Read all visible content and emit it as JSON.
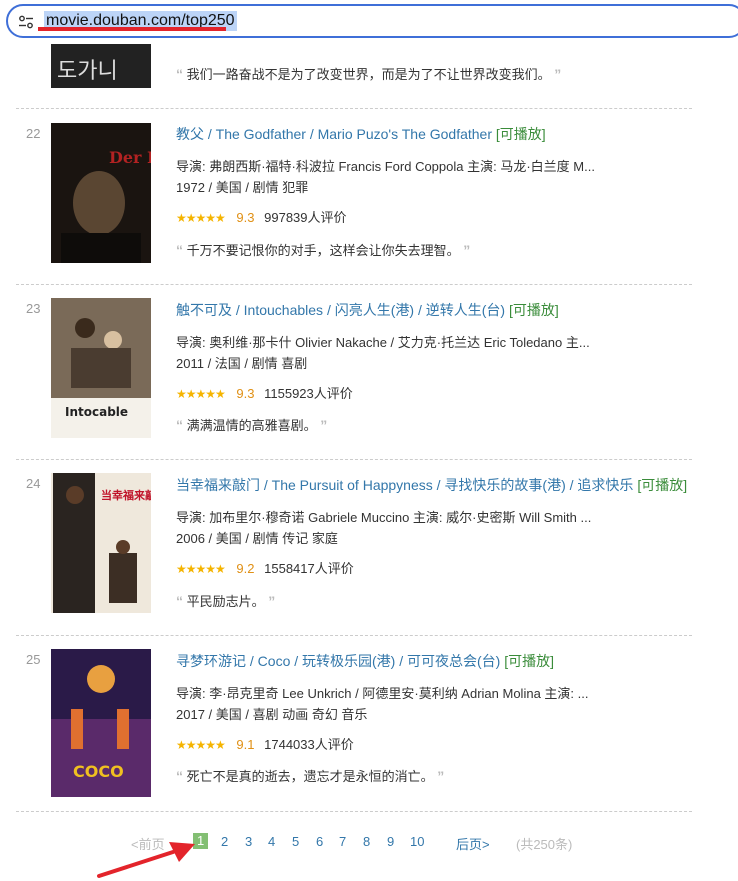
{
  "browser": {
    "url": "movie.douban.com/top250"
  },
  "items": [
    {
      "quote": "我们一路奋战不是为了改变世界，而是为了不让世界改变我们。"
    },
    {
      "rank": "22",
      "title_main": "教父",
      "title_other": " / The Godfather  / Mario Puzo's The Godfather",
      "playable": "[可播放]",
      "meta1": "导演: 弗朗西斯·福特·科波拉 Francis Ford Coppola   主演: 马龙·白兰度 M...",
      "meta2": "1972 / 美国 / 剧情 犯罪",
      "stars": "★★★★★",
      "score": "9.3",
      "votes": "997839人评价",
      "quote": "千万不要记恨你的对手，这样会让你失去理智。"
    },
    {
      "rank": "23",
      "title_main": "触不可及",
      "title_other": " / Intouchables  / 闪亮人生(港) / 逆转人生(台)",
      "playable": "[可播放]",
      "meta1": "导演: 奥利维·那卡什 Olivier Nakache / 艾力克·托兰达 Eric Toledano   主...",
      "meta2": "2011 / 法国 / 剧情 喜剧",
      "stars": "★★★★★",
      "score": "9.3",
      "votes": "1155923人评价",
      "quote": "满满温情的高雅喜剧。"
    },
    {
      "rank": "24",
      "title_main": "当幸福来敲门",
      "title_other": " / The Pursuit of Happyness  / 寻找快乐的故事(港) / 追求快乐",
      "playable": "[可播放]",
      "meta1": "导演: 加布里尔·穆奇诺 Gabriele Muccino   主演: 威尔·史密斯 Will Smith ...",
      "meta2": "2006 / 美国 / 剧情 传记 家庭",
      "stars": "★★★★★",
      "score": "9.2",
      "votes": "1558417人评价",
      "quote": "平民励志片。"
    },
    {
      "rank": "25",
      "title_main": "寻梦环游记",
      "title_other": " / Coco  / 玩转极乐园(港) / 可可夜总会(台)",
      "playable": "[可播放]",
      "meta1": "导演: 李·昂克里奇 Lee Unkrich / 阿德里安·莫利纳 Adrian Molina   主演: ...",
      "meta2": "2017 / 美国 / 喜剧 动画 奇幻 音乐",
      "stars": "★★★★★",
      "score": "9.1",
      "votes": "1744033人评价",
      "quote": "死亡不是真的逝去，遗忘才是永恒的消亡。"
    }
  ],
  "poster_text": {
    "p0": "도가니",
    "p1": "Der Pate",
    "p2": "Intocable",
    "p3": "当幸福来敲门",
    "p4": "COCO"
  },
  "pagination": {
    "prev": "<前页",
    "pages": [
      "1",
      "2",
      "3",
      "4",
      "5",
      "6",
      "7",
      "8",
      "9",
      "10"
    ],
    "current": "1",
    "next": "后页>",
    "total": "(共250条)"
  },
  "quote_open": "“",
  "quote_close": "”",
  "colors": {
    "link": "#3377aa",
    "playable": "#3a8c3a",
    "star": "#f5b400",
    "score": "#e09015",
    "current_page": "#83bf73",
    "annotation": "#e3242b"
  }
}
